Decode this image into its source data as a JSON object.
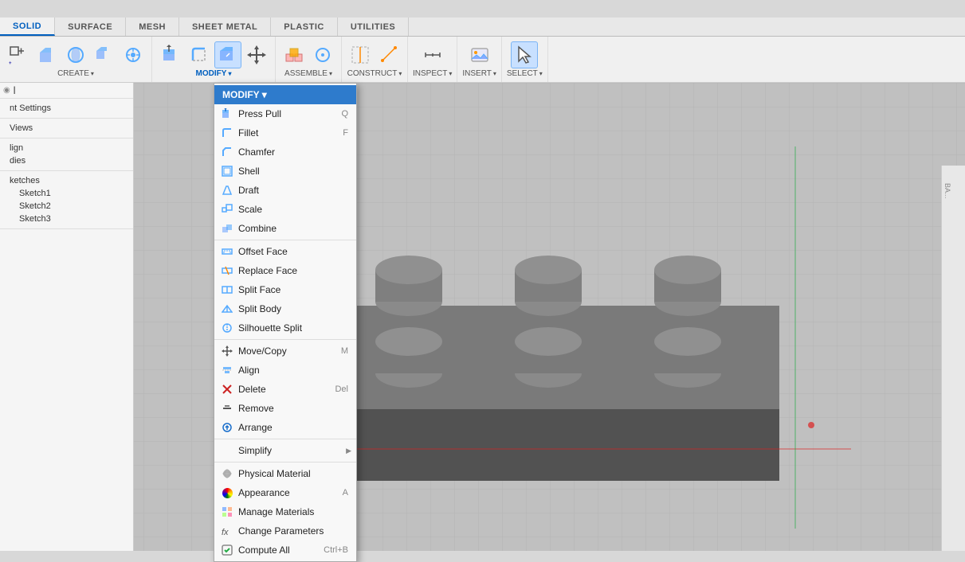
{
  "tabs": [
    {
      "id": "solid",
      "label": "SOLID",
      "active": true
    },
    {
      "id": "surface",
      "label": "SURFACE"
    },
    {
      "id": "mesh",
      "label": "MESH"
    },
    {
      "id": "sheet_metal",
      "label": "SHEET METAL"
    },
    {
      "id": "plastic",
      "label": "PLASTIC"
    },
    {
      "id": "utilities",
      "label": "UTILITIES"
    }
  ],
  "toolbar_groups": [
    {
      "id": "create",
      "label": "CREATE",
      "has_arrow": true
    },
    {
      "id": "modify",
      "label": "MODIFY",
      "has_arrow": true,
      "active": true
    },
    {
      "id": "assemble",
      "label": "ASSEMBLE",
      "has_arrow": true
    },
    {
      "id": "construct",
      "label": "CONSTRUCT",
      "has_arrow": true
    },
    {
      "id": "inspect",
      "label": "INSPECT",
      "has_arrow": true
    },
    {
      "id": "insert",
      "label": "INSERT",
      "has_arrow": true
    },
    {
      "id": "select",
      "label": "SELECT",
      "has_arrow": true
    }
  ],
  "modify_menu": {
    "header": "MODIFY",
    "items": [
      {
        "id": "press_pull",
        "label": "Press Pull",
        "shortcut": "Q",
        "icon": "rect_press"
      },
      {
        "id": "fillet",
        "label": "Fillet",
        "shortcut": "F",
        "icon": "fillet"
      },
      {
        "id": "chamfer",
        "label": "Chamfer",
        "shortcut": "",
        "icon": "chamfer"
      },
      {
        "id": "shell",
        "label": "Shell",
        "shortcut": "",
        "icon": "shell"
      },
      {
        "id": "draft",
        "label": "Draft",
        "shortcut": "",
        "icon": "draft"
      },
      {
        "id": "scale",
        "label": "Scale",
        "shortcut": "",
        "icon": "scale"
      },
      {
        "id": "combine",
        "label": "Combine",
        "shortcut": "",
        "icon": "combine"
      },
      {
        "id": "offset_face",
        "label": "Offset Face",
        "shortcut": "",
        "icon": "offset_face"
      },
      {
        "id": "replace_face",
        "label": "Replace Face",
        "shortcut": "",
        "icon": "replace_face"
      },
      {
        "id": "split_face",
        "label": "Split Face",
        "shortcut": "",
        "icon": "split_face"
      },
      {
        "id": "split_body",
        "label": "Split Body",
        "shortcut": "",
        "icon": "split_body"
      },
      {
        "id": "silhouette_split",
        "label": "Silhouette Split",
        "shortcut": "",
        "icon": "silhouette_split"
      },
      {
        "id": "move_copy",
        "label": "Move/Copy",
        "shortcut": "M",
        "icon": "move"
      },
      {
        "id": "align",
        "label": "Align",
        "shortcut": "",
        "icon": "align"
      },
      {
        "id": "delete",
        "label": "Delete",
        "shortcut": "Del",
        "icon": "delete"
      },
      {
        "id": "remove",
        "label": "Remove",
        "shortcut": "",
        "icon": "remove"
      },
      {
        "id": "arrange",
        "label": "Arrange",
        "shortcut": "",
        "icon": "arrange"
      },
      {
        "id": "simplify",
        "label": "Simplify",
        "shortcut": "",
        "icon": "simplify",
        "has_submenu": true
      },
      {
        "id": "physical_material",
        "label": "Physical Material",
        "shortcut": "",
        "icon": "physical_material"
      },
      {
        "id": "appearance",
        "label": "Appearance",
        "shortcut": "A",
        "icon": "appearance"
      },
      {
        "id": "manage_materials",
        "label": "Manage Materials",
        "shortcut": "",
        "icon": "manage_materials"
      },
      {
        "id": "change_parameters",
        "label": "Change Parameters",
        "shortcut": "",
        "icon": "change_parameters"
      },
      {
        "id": "compute_all",
        "label": "Compute All",
        "shortcut": "Ctrl+B",
        "icon": "compute_all"
      }
    ]
  },
  "sidebar": {
    "sections": [
      {
        "title": "nt Settings",
        "items": []
      },
      {
        "title": "Views",
        "items": []
      },
      {
        "title": "lign",
        "items": []
      },
      {
        "title": "dies",
        "items": []
      },
      {
        "title": "ketches",
        "items": [
          {
            "label": "Sketch1"
          },
          {
            "label": "Sketch2"
          },
          {
            "label": "Sketch3"
          }
        ]
      }
    ]
  },
  "status_bar": {
    "text": "BA..."
  }
}
